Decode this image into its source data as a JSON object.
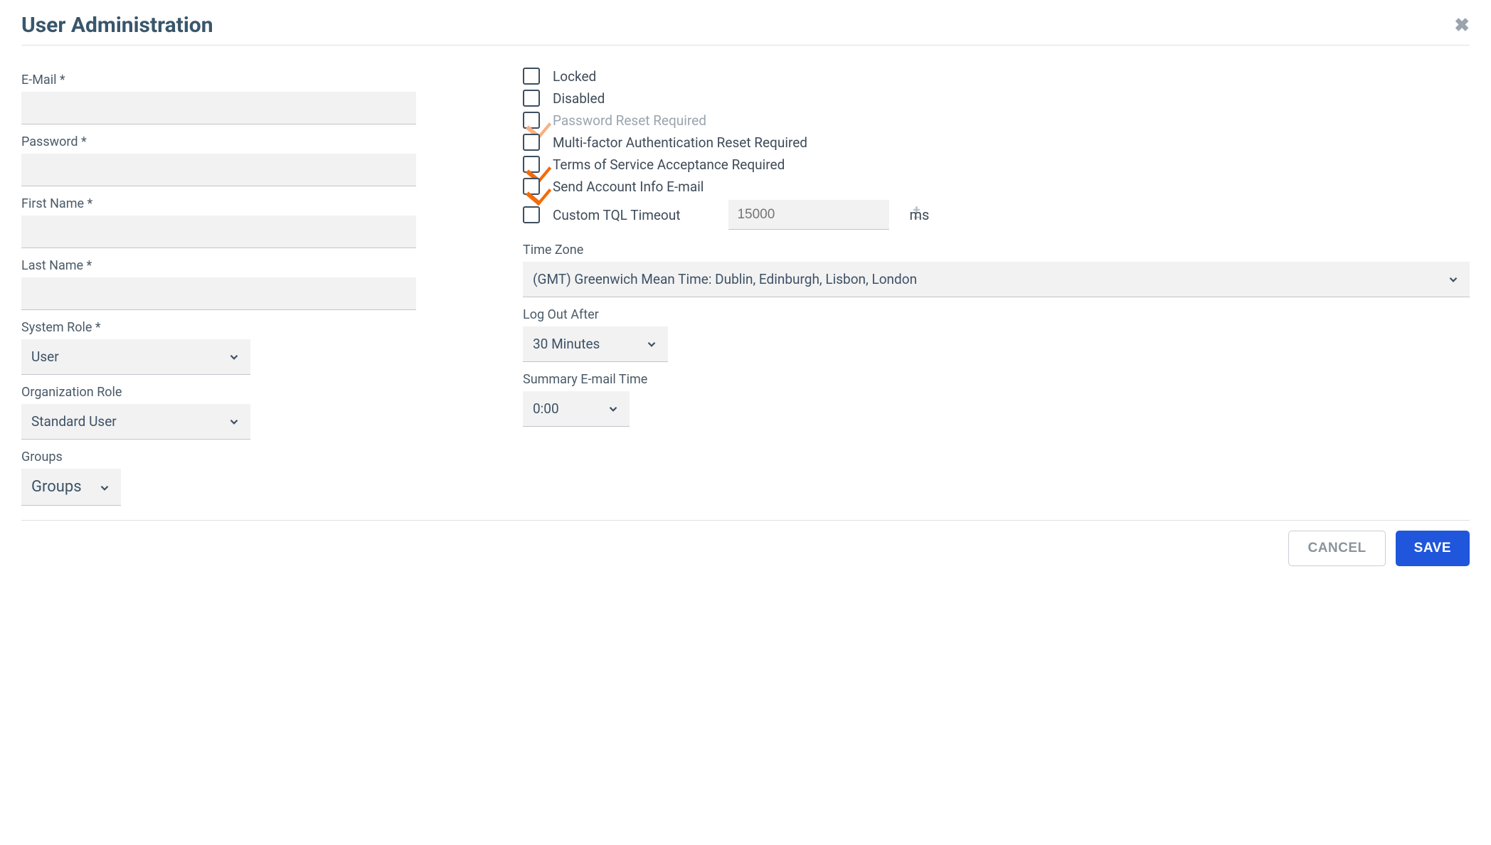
{
  "dialog": {
    "title": "User Administration"
  },
  "left": {
    "email_label": "E-Mail *",
    "email_value": "",
    "password_label": "Password *",
    "password_value": "",
    "first_name_label": "First Name *",
    "first_name_value": "",
    "last_name_label": "Last Name *",
    "last_name_value": "",
    "system_role_label": "System Role *",
    "system_role_value": "User",
    "org_role_label": "Organization Role",
    "org_role_value": "Standard User",
    "groups_label": "Groups",
    "groups_value": "Groups"
  },
  "right": {
    "locked_label": "Locked",
    "locked_checked": false,
    "disabled_label": "Disabled",
    "disabled_checked": false,
    "pw_reset_label": "Password Reset Required",
    "pw_reset_checked": true,
    "pw_reset_dim": true,
    "mfa_reset_label": "Multi-factor Authentication Reset Required",
    "mfa_reset_checked": false,
    "tos_label": "Terms of Service Acceptance Required",
    "tos_checked": true,
    "send_email_label": "Send Account Info E-mail",
    "send_email_checked": true,
    "tql_label": "Custom TQL Timeout",
    "tql_checked": false,
    "tql_placeholder": "15000",
    "tql_unit": "ms",
    "timezone_label": "Time Zone",
    "timezone_value": "(GMT) Greenwich Mean Time: Dublin, Edinburgh, Lisbon, London",
    "logout_label": "Log Out After",
    "logout_value": "30 Minutes",
    "summary_label": "Summary E-mail Time",
    "summary_value": "0:00"
  },
  "footer": {
    "cancel": "CANCEL",
    "save": "SAVE"
  }
}
